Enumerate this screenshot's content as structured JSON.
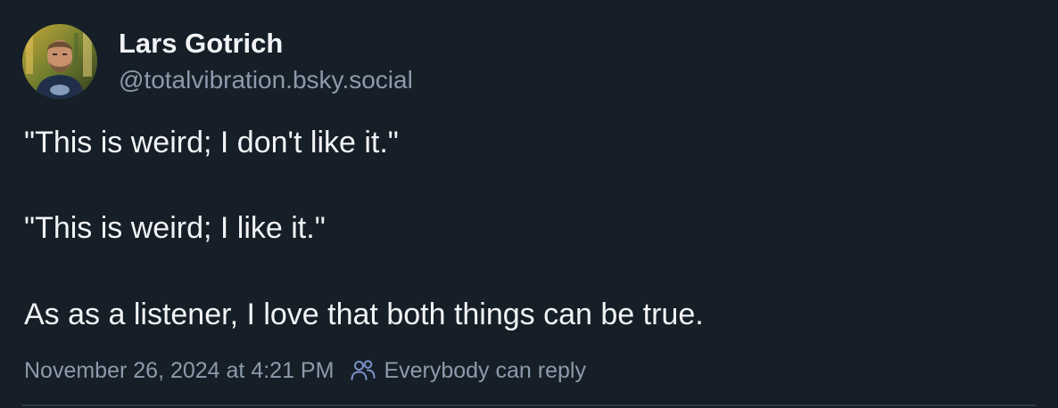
{
  "post": {
    "author": {
      "display_name": "Lars Gotrich",
      "handle": "@totalvibration.bsky.social",
      "avatar_icon": "user-avatar"
    },
    "text_lines": [
      "\"This is weird; I don't like it.\"",
      "\"This is weird; I like it.\"",
      "As as a listener, I love that both things can be true."
    ],
    "timestamp": "November 26, 2024 at 4:21 PM",
    "reply_setting": {
      "icon": "people-icon",
      "label": "Everybody can reply"
    }
  },
  "colors": {
    "background": "#161e27",
    "primary_text": "#f1f3f5",
    "secondary_text": "#8c9bab",
    "divider": "#2e3a47"
  }
}
